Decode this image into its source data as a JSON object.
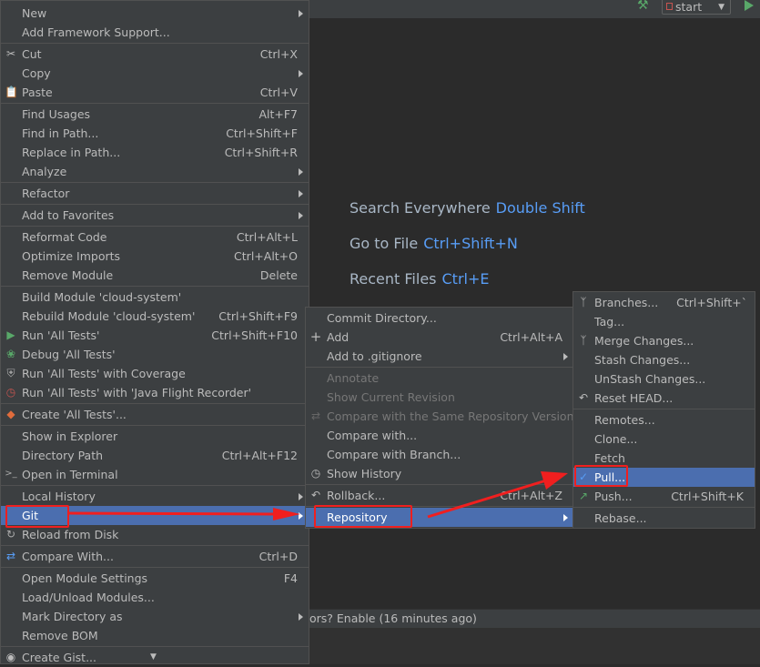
{
  "toolbar": {
    "run_config_label": "start"
  },
  "hints": [
    {
      "label": "Search Everywhere",
      "key": "Double Shift"
    },
    {
      "label": "Go to File",
      "key": "Ctrl+Shift+N"
    },
    {
      "label": "Recent Files",
      "key": "Ctrl+E"
    }
  ],
  "status_text": "ors? Enable (16 minutes ago)",
  "context_menu": {
    "items": {
      "new": {
        "label": "New"
      },
      "add_framework": {
        "label": "Add Framework Support..."
      },
      "cut": {
        "label": "Cut",
        "shortcut": "Ctrl+X"
      },
      "copy": {
        "label": "Copy"
      },
      "paste": {
        "label": "Paste",
        "shortcut": "Ctrl+V"
      },
      "find_usages": {
        "label": "Find Usages",
        "shortcut": "Alt+F7"
      },
      "find_in_path": {
        "label": "Find in Path...",
        "shortcut": "Ctrl+Shift+F"
      },
      "replace_in_path": {
        "label": "Replace in Path...",
        "shortcut": "Ctrl+Shift+R"
      },
      "analyze": {
        "label": "Analyze"
      },
      "refactor": {
        "label": "Refactor"
      },
      "add_to_favorites": {
        "label": "Add to Favorites"
      },
      "reformat_code": {
        "label": "Reformat Code",
        "shortcut": "Ctrl+Alt+L"
      },
      "optimize_imports": {
        "label": "Optimize Imports",
        "shortcut": "Ctrl+Alt+O"
      },
      "remove_module": {
        "label": "Remove Module",
        "shortcut": "Delete"
      },
      "build_module": {
        "label": "Build Module 'cloud-system'"
      },
      "rebuild_module": {
        "label": "Rebuild Module 'cloud-system'",
        "shortcut": "Ctrl+Shift+F9"
      },
      "run_tests": {
        "label": "Run 'All Tests'",
        "shortcut": "Ctrl+Shift+F10"
      },
      "debug_tests": {
        "label": "Debug 'All Tests'"
      },
      "run_coverage": {
        "label": "Run 'All Tests' with Coverage"
      },
      "run_jfr": {
        "label": "Run 'All Tests' with 'Java Flight Recorder'"
      },
      "create_tests": {
        "label": "Create 'All Tests'..."
      },
      "show_in_explorer": {
        "label": "Show in Explorer"
      },
      "directory_path": {
        "label": "Directory Path",
        "shortcut": "Ctrl+Alt+F12"
      },
      "open_in_terminal": {
        "label": "Open in Terminal"
      },
      "local_history": {
        "label": "Local History"
      },
      "git": {
        "label": "Git"
      },
      "reload_from_disk": {
        "label": "Reload from Disk"
      },
      "compare_with": {
        "label": "Compare With...",
        "shortcut": "Ctrl+D"
      },
      "open_module_settings": {
        "label": "Open Module Settings",
        "shortcut": "F4"
      },
      "load_unload_modules": {
        "label": "Load/Unload Modules..."
      },
      "mark_directory_as": {
        "label": "Mark Directory as"
      },
      "remove_bom": {
        "label": "Remove BOM"
      },
      "create_gist": {
        "label": "Create Gist..."
      }
    }
  },
  "git_menu": {
    "items": {
      "commit_directory": {
        "label": "Commit Directory..."
      },
      "add": {
        "label": "Add",
        "shortcut": "Ctrl+Alt+A"
      },
      "add_gitignore": {
        "label": "Add to .gitignore"
      },
      "annotate": {
        "label": "Annotate"
      },
      "show_current_revision": {
        "label": "Show Current Revision"
      },
      "compare_same_repo": {
        "label": "Compare with the Same Repository Version"
      },
      "compare_with": {
        "label": "Compare with..."
      },
      "compare_with_branch": {
        "label": "Compare with Branch..."
      },
      "show_history": {
        "label": "Show History"
      },
      "rollback": {
        "label": "Rollback...",
        "shortcut": "Ctrl+Alt+Z"
      },
      "repository": {
        "label": "Repository"
      }
    }
  },
  "repository_menu": {
    "items": {
      "branches": {
        "label": "Branches...",
        "shortcut": "Ctrl+Shift+`"
      },
      "tag": {
        "label": "Tag..."
      },
      "merge_changes": {
        "label": "Merge Changes..."
      },
      "stash_changes": {
        "label": "Stash Changes..."
      },
      "unstash_changes": {
        "label": "UnStash Changes..."
      },
      "reset_head": {
        "label": "Reset HEAD..."
      },
      "remotes": {
        "label": "Remotes..."
      },
      "clone": {
        "label": "Clone..."
      },
      "fetch": {
        "label": "Fetch"
      },
      "pull": {
        "label": "Pull..."
      },
      "push": {
        "label": "Push...",
        "shortcut": "Ctrl+Shift+K"
      },
      "rebase": {
        "label": "Rebase..."
      }
    }
  }
}
